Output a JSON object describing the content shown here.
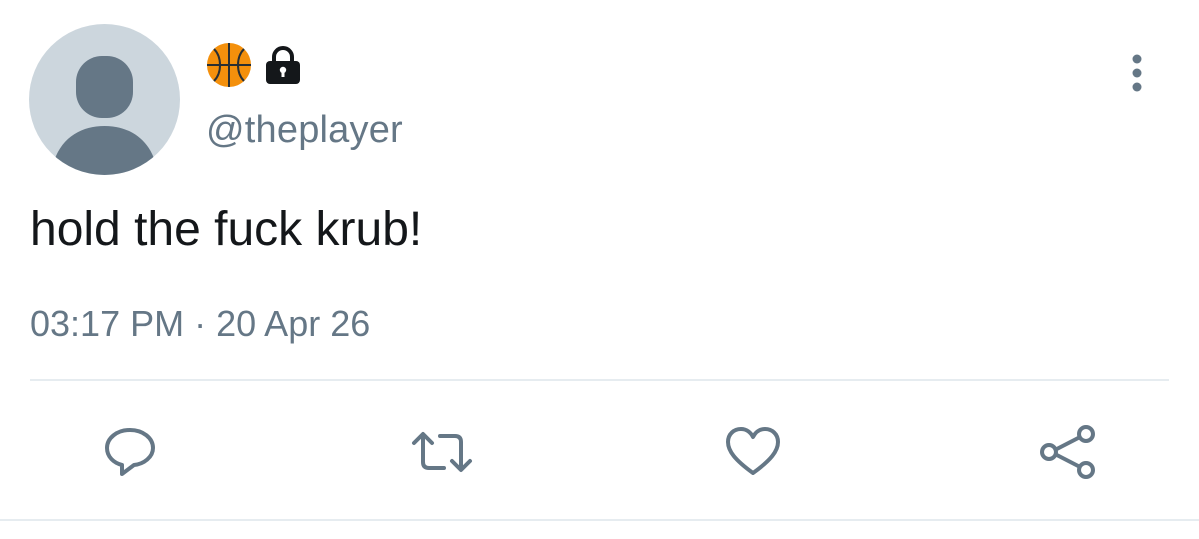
{
  "user": {
    "handle": "@theplayer",
    "display_name_icons": [
      "basketball-icon",
      "lock-icon"
    ]
  },
  "tweet": {
    "text": "hold the fuck krub!",
    "time": "03:17 PM",
    "separator": "·",
    "date": "20 Apr 26"
  },
  "actions": [
    "reply-icon",
    "retweet-icon",
    "like-icon",
    "share-icon"
  ],
  "colors": {
    "text": "#14171a",
    "secondary": "#657786",
    "avatar_bg": "#ccd6dd",
    "avatar_fg": "#657786",
    "basketball": "#f4900c",
    "divider": "#e6ecf0"
  }
}
